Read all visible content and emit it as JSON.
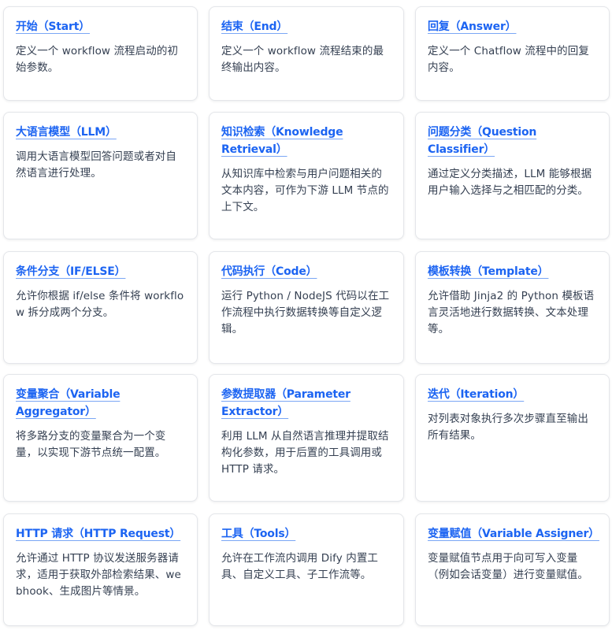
{
  "nodes": [
    {
      "title": "开始（Start）",
      "desc": "定义一个 workflow 流程启动的初始参数。"
    },
    {
      "title": "结束（End）",
      "desc": "定义一个 workflow 流程结束的最终输出内容。"
    },
    {
      "title": "回复（Answer）",
      "desc": "定义一个 Chatflow 流程中的回复内容。"
    },
    {
      "title": "大语言模型（LLM）",
      "desc": "调用大语言模型回答问题或者对自然语言进行处理。"
    },
    {
      "title": "知识检索（Knowledge Retrieval）",
      "desc": "从知识库中检索与用户问题相关的文本内容，可作为下游 LLM 节点的上下文。"
    },
    {
      "title": "问题分类（Question Classifier）",
      "desc": "通过定义分类描述，LLM 能够根据用户输入选择与之相匹配的分类。"
    },
    {
      "title": "条件分支（IF/ELSE）",
      "desc": "允许你根据 if/else 条件将 workflow 拆分成两个分支。"
    },
    {
      "title": "代码执行（Code）",
      "desc": "运行 Python / NodeJS 代码以在工作流程中执行数据转换等自定义逻辑。"
    },
    {
      "title": "模板转换（Template）",
      "desc": "允许借助 Jinja2 的 Python 模板语言灵活地进行数据转换、文本处理等。"
    },
    {
      "title": "变量聚合（Variable Aggregator）",
      "desc": "将多路分支的变量聚合为一个变量，以实现下游节点统一配置。"
    },
    {
      "title": "参数提取器（Parameter Extractor）",
      "desc": "利用 LLM 从自然语言推理并提取结构化参数，用于后置的工具调用或 HTTP 请求。"
    },
    {
      "title": "迭代（Iteration）",
      "desc": "对列表对象执行多次步骤直至输出所有结果。"
    },
    {
      "title": "HTTP 请求（HTTP Request）",
      "desc": "允许通过 HTTP 协议发送服务器请求，适用于获取外部检索结果、webhook、生成图片等情景。"
    },
    {
      "title": "工具（Tools）",
      "desc": "允许在工作流内调用 Dify 内置工具、自定义工具、子工作流等。"
    },
    {
      "title": "变量赋值（Variable Assigner）",
      "desc": "变量赋值节点用于向可写入变量（例如会话变量）进行变量赋值。"
    }
  ],
  "colors": {
    "link": "#1c64f2",
    "text": "#354052",
    "border": "#e4e6ea"
  }
}
